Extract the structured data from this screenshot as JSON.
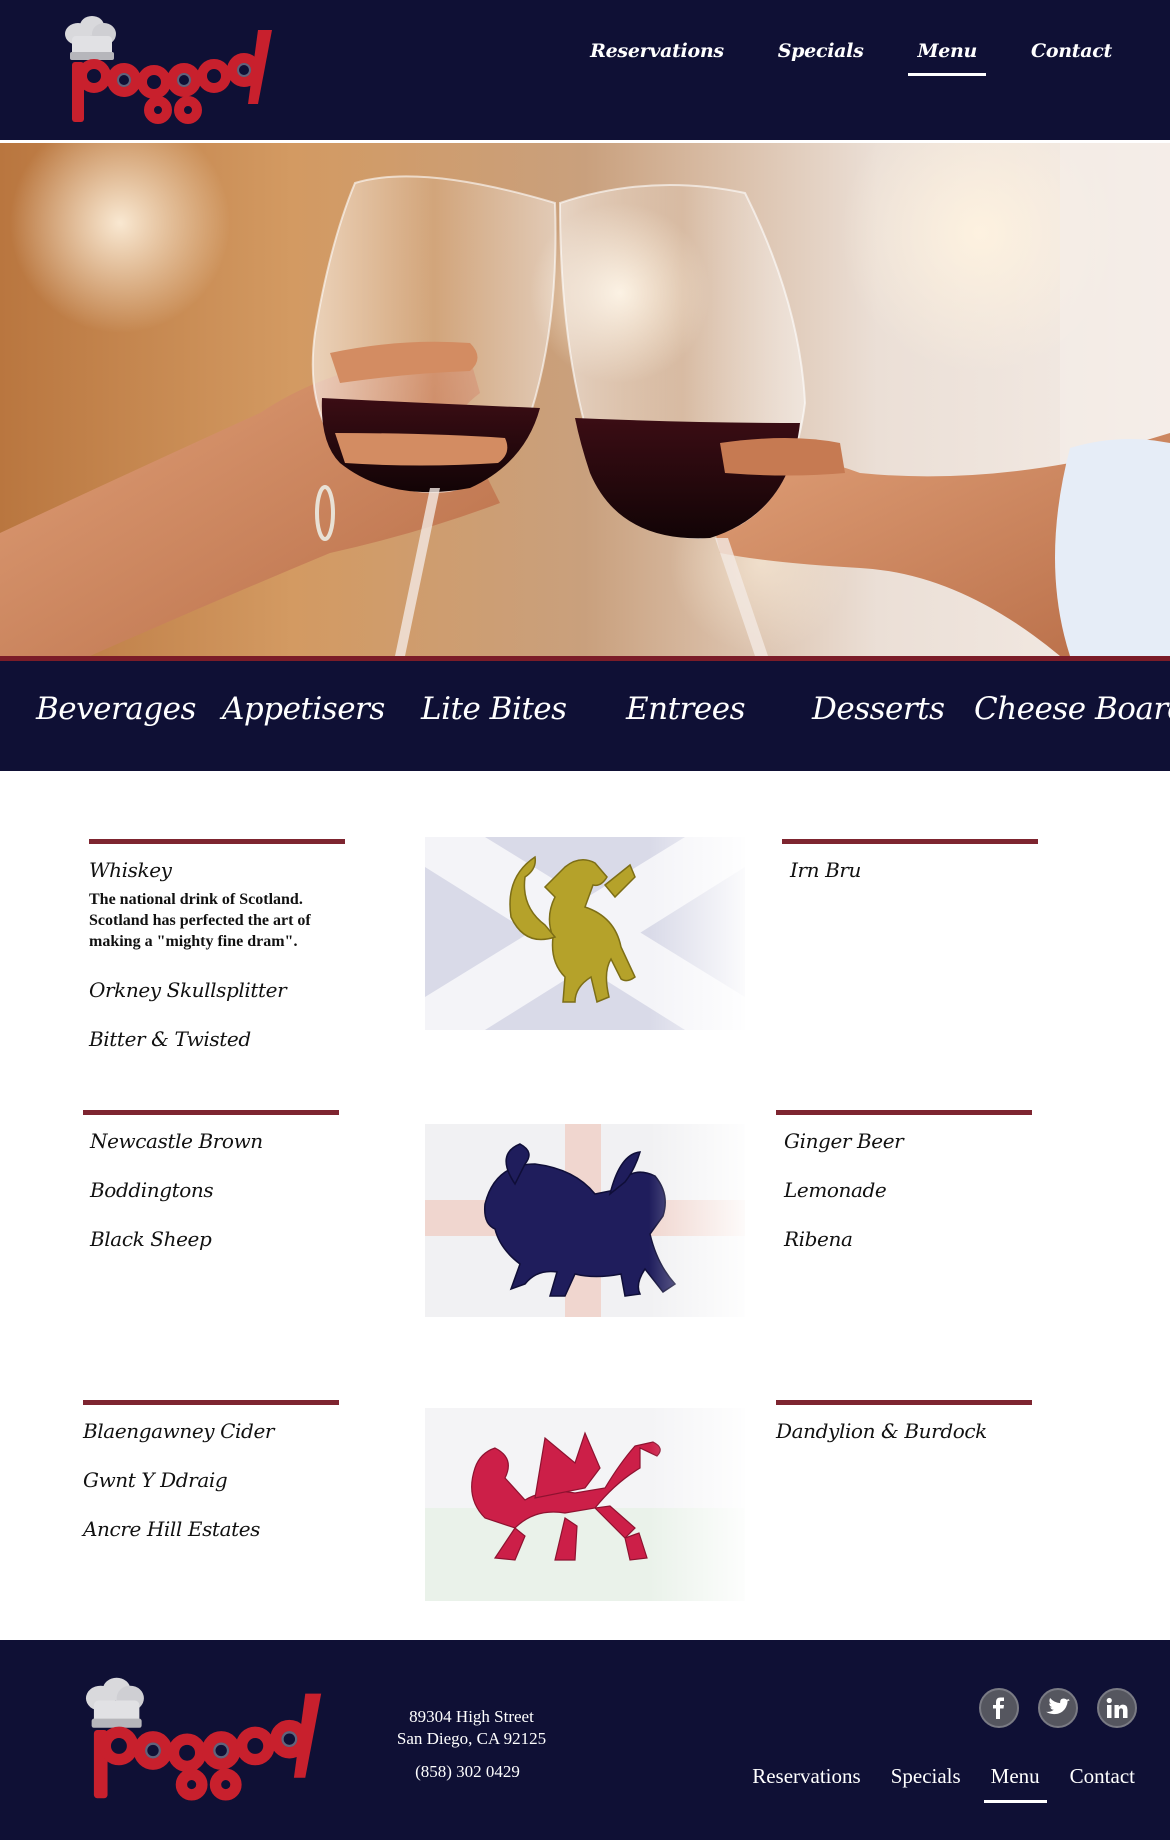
{
  "brand": {
    "logo_text": "Pogged",
    "colors": {
      "navy": "#0f1035",
      "maroon": "#7e2530",
      "logo_red": "#c8202d",
      "chef_hat": "#d9d9dc"
    }
  },
  "nav": {
    "items": [
      {
        "label": "Reservations",
        "active": false
      },
      {
        "label": "Specials",
        "active": false
      },
      {
        "label": "Menu",
        "active": true
      },
      {
        "label": "Contact",
        "active": false
      }
    ]
  },
  "hero": {
    "image": "two-wine-glasses-toasting-photo"
  },
  "categories": [
    "Beverages",
    "Appetisers",
    "Lite Bites",
    "Entrees",
    "Desserts",
    "Cheese Board"
  ],
  "menu": {
    "scotland": {
      "flag": "scottish-lion-rampant-saltire-flag",
      "left": {
        "items": [
          "Whiskey",
          "Orkney Skullsplitter",
          "Bitter & Twisted"
        ],
        "description": "The national drink of Scotland. Scotland has perfected the art of making a \"mighty fine dram\"."
      },
      "right": {
        "items": [
          "Irn Bru"
        ]
      }
    },
    "england": {
      "flag": "english-lion-st-george-flag",
      "left": {
        "items": [
          "Newcastle Brown",
          "Boddingtons",
          "Black Sheep"
        ]
      },
      "right": {
        "items": [
          "Ginger Beer",
          "Lemonade",
          "Ribena"
        ]
      }
    },
    "wales": {
      "flag": "welsh-red-dragon-flag",
      "left": {
        "items": [
          "Blaengawney Cider",
          "Gwnt Y Ddraig",
          "Ancre Hill Estates"
        ]
      },
      "right": {
        "items": [
          "Dandylion & Burdock"
        ]
      }
    }
  },
  "footer": {
    "address_line1": "89304 High Street",
    "address_line2": "San Diego, CA 92125",
    "phone": "(858) 302 0429",
    "social": [
      "facebook-icon",
      "twitter-icon",
      "linkedin-icon"
    ],
    "nav": [
      {
        "label": "Reservations",
        "active": false
      },
      {
        "label": "Specials",
        "active": false
      },
      {
        "label": "Menu",
        "active": true
      },
      {
        "label": "Contact",
        "active": false
      }
    ]
  }
}
